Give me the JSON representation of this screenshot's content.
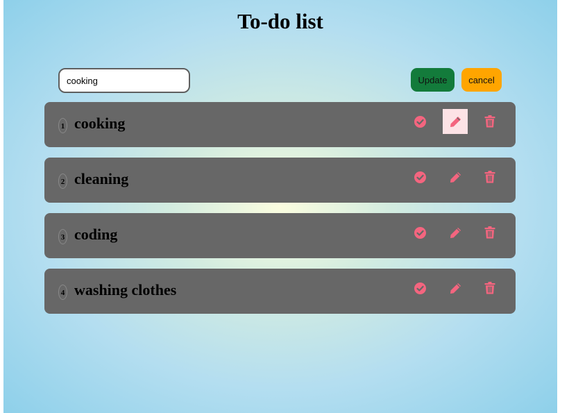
{
  "app": {
    "title": "To-do list"
  },
  "form": {
    "input_value": "cooking",
    "update_label": "Update",
    "cancel_label": "cancel"
  },
  "todos": [
    {
      "number": "1",
      "text": "cooking",
      "editing": true
    },
    {
      "number": "2",
      "text": "cleaning",
      "editing": false
    },
    {
      "number": "3",
      "text": "coding",
      "editing": false
    },
    {
      "number": "4",
      "text": "washing clothes",
      "editing": false
    }
  ],
  "icons": {
    "complete": "check-circle-icon",
    "edit": "pencil-icon",
    "delete": "trash-icon"
  },
  "colors": {
    "accent": "#f4657f",
    "row_background": "#676767",
    "update_button": "#137b3b",
    "cancel_button": "#ffa500",
    "edit_highlight": "#fde3e6"
  }
}
